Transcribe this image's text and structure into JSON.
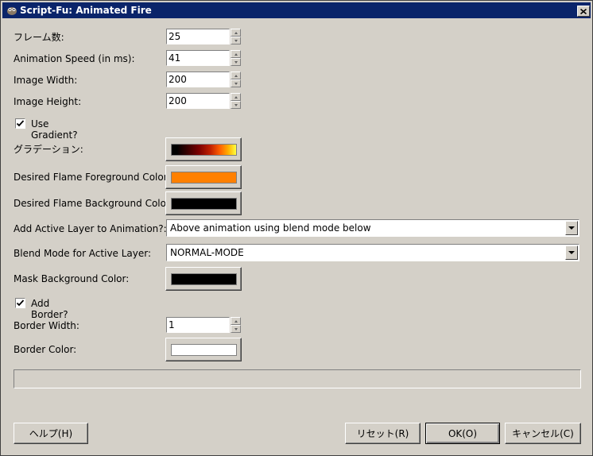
{
  "window": {
    "title": "Script-Fu: Animated Fire"
  },
  "fields": {
    "frames": {
      "label": "フレーム数:",
      "value": "25"
    },
    "speed": {
      "label": "Animation Speed (in ms):",
      "value": "41"
    },
    "width": {
      "label": "Image Width:",
      "value": "200"
    },
    "height": {
      "label": "Image Height:",
      "value": "200"
    },
    "use_gradient": {
      "label": "Use Gradient?",
      "checked": true
    },
    "gradient": {
      "label": "グラデーション:"
    },
    "fg_color": {
      "label": "Desired Flame Foreground Color:",
      "color": "#ff8000"
    },
    "bg_color": {
      "label": "Desired Flame Background Color:",
      "color": "#000000"
    },
    "add_layer": {
      "label": "Add Active Layer to Animation?:",
      "value": "Above animation using blend mode below"
    },
    "blend_mode": {
      "label": "Blend Mode for Active Layer:",
      "value": "NORMAL-MODE"
    },
    "mask_bg": {
      "label": "Mask Background Color:",
      "color": "#000000"
    },
    "add_border": {
      "label": "Add Border?",
      "checked": true
    },
    "border_width": {
      "label": "Border Width:",
      "value": "1"
    },
    "border_color": {
      "label": "Border Color:",
      "color": "#ffffff"
    }
  },
  "progress": {
    "fraction": 0
  },
  "buttons": {
    "help": "ヘルプ(H)",
    "reset": "リセット(R)",
    "ok": "OK(O)",
    "cancel": "キャンセル(C)"
  },
  "colors": {
    "titlebar": "#0a246a",
    "face": "#d4d0c8"
  }
}
